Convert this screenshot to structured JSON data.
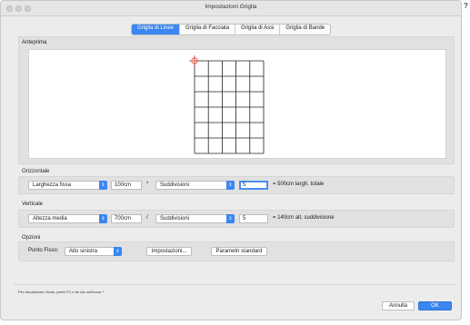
{
  "window": {
    "title": "Impostazioni Griglia",
    "help_label": "?"
  },
  "tabs": [
    {
      "label": "Griglia di Linee",
      "active": true
    },
    {
      "label": "Griglia di Facciata",
      "active": false
    },
    {
      "label": "Griglia di Assi",
      "active": false
    },
    {
      "label": "Griglia di Bande",
      "active": false
    }
  ],
  "preview": {
    "label": "Anteprima",
    "grid": {
      "columns": 5,
      "rows": 6
    }
  },
  "orizzontale": {
    "label": "Orizzontale",
    "mode": "Larghezza fissa",
    "size": "100cm",
    "operator": "*",
    "method": "Suddivisioni",
    "count": "5",
    "result": "= 500cm largh. totale"
  },
  "verticale": {
    "label": "Verticale",
    "mode": "Altezza media",
    "size": "700cm",
    "operator": "/",
    "method": "Suddivisioni",
    "count": "5",
    "result": "= 140cm alt. suddivisione"
  },
  "opzioni": {
    "label": "Opzioni",
    "punto_fisso_label": "Punto Fisso:",
    "punto_fisso_value": "Alto sinistra",
    "impostazioni_label": "Impostazioni...",
    "parametri_label": "Parametri standard"
  },
  "status": {
    "text": "Per visualizzare l'Aiuto, premi F1 o fai clic sull'icona ?"
  },
  "footer": {
    "cancel_label": "Annulla",
    "ok_label": "OK"
  },
  "colors": {
    "accent": "#3b86f0",
    "crosshair": "#e23a2a"
  }
}
